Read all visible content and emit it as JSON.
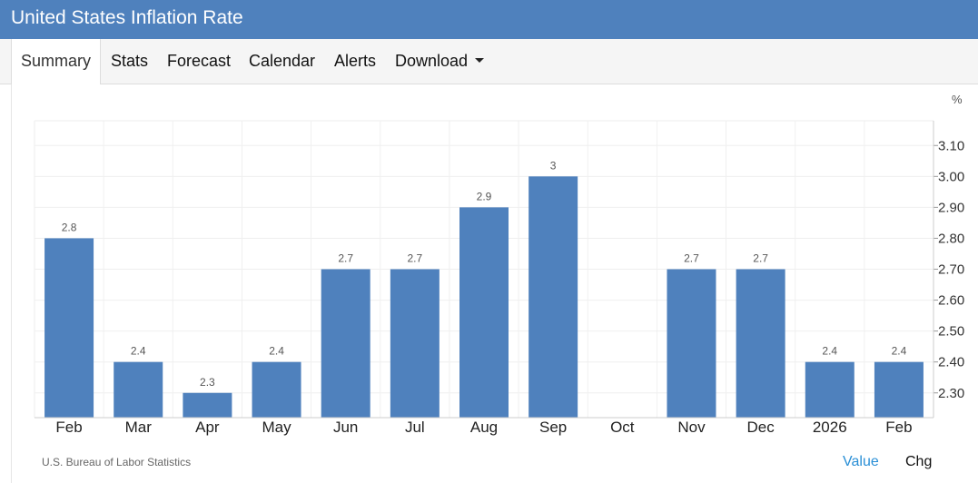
{
  "title": "United States Inflation Rate",
  "tabs": [
    {
      "label": "Summary",
      "active": true
    },
    {
      "label": "Stats",
      "active": false
    },
    {
      "label": "Forecast",
      "active": false
    },
    {
      "label": "Calendar",
      "active": false
    },
    {
      "label": "Alerts",
      "active": false
    },
    {
      "label": "Download",
      "active": false
    }
  ],
  "colors": {
    "bar": "#4f81bd",
    "header": "#4f81bd",
    "link": "#2a8fd6"
  },
  "icons": {
    "download_menu": "caret-down-icon"
  },
  "chart_data": {
    "type": "bar",
    "unit_label": "%",
    "categories": [
      "Feb",
      "Mar",
      "Apr",
      "May",
      "Jun",
      "Jul",
      "Aug",
      "Sep",
      "Oct",
      "Nov",
      "Dec",
      "2026",
      "Feb"
    ],
    "values": [
      2.8,
      2.4,
      2.3,
      2.4,
      2.7,
      2.7,
      2.9,
      3,
      null,
      2.7,
      2.7,
      2.4,
      2.4
    ],
    "data_labels": [
      "2.8",
      "2.4",
      "2.3",
      "2.4",
      "2.7",
      "2.7",
      "2.9",
      "3",
      "",
      "2.7",
      "2.7",
      "2.4",
      "2.4"
    ],
    "y_ticks": [
      "2.30",
      "2.40",
      "2.50",
      "2.60",
      "2.70",
      "2.80",
      "2.90",
      "3.00",
      "3.10"
    ],
    "ylim": [
      2.22,
      3.18
    ],
    "y_axis_position": "right",
    "grid": true
  },
  "footer": {
    "source": "U.S. Bureau of Labor Statistics",
    "toggle_value": "Value",
    "toggle_change": "Chg"
  }
}
